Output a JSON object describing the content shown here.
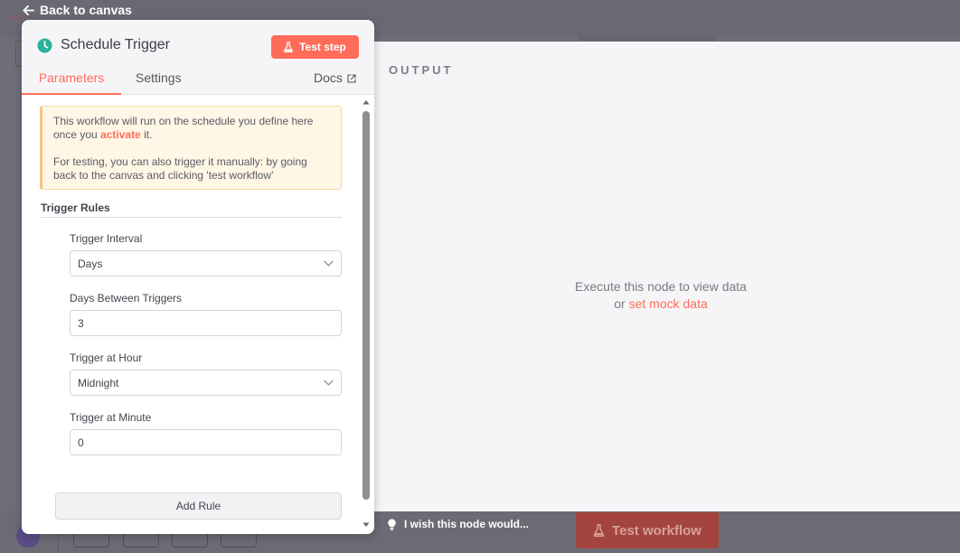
{
  "back_label": "Back to canvas",
  "node": {
    "title": "Schedule Trigger",
    "test_step_label": "Test step"
  },
  "tabs": {
    "parameters": "Parameters",
    "settings": "Settings",
    "docs": "Docs"
  },
  "notice": {
    "line1_before": "This workflow will run on the schedule you define here once you ",
    "line1_link": "activate",
    "line1_after": " it.",
    "line2": "For testing, you can also trigger it manually: by going back to the canvas and clicking 'test workflow'"
  },
  "trigger_rules": {
    "title": "Trigger Rules",
    "interval_label": "Trigger Interval",
    "interval_value": "Days",
    "days_between_label": "Days Between Triggers",
    "days_between_value": "3",
    "hour_label": "Trigger at Hour",
    "hour_value": "Midnight",
    "minute_label": "Trigger at Minute",
    "minute_value": "0",
    "add_rule_label": "Add Rule"
  },
  "output": {
    "title": "OUTPUT",
    "empty_line1": "Execute this node to view data",
    "empty_or": "or ",
    "empty_link": "set mock data"
  },
  "footer": {
    "feedback_label": "I wish this node would...",
    "test_workflow_label": "Test workflow"
  },
  "colors": {
    "accent": "#ff6d5a",
    "trigger_icon": "#2bb09b",
    "notice_bg": "#fff6e6"
  }
}
